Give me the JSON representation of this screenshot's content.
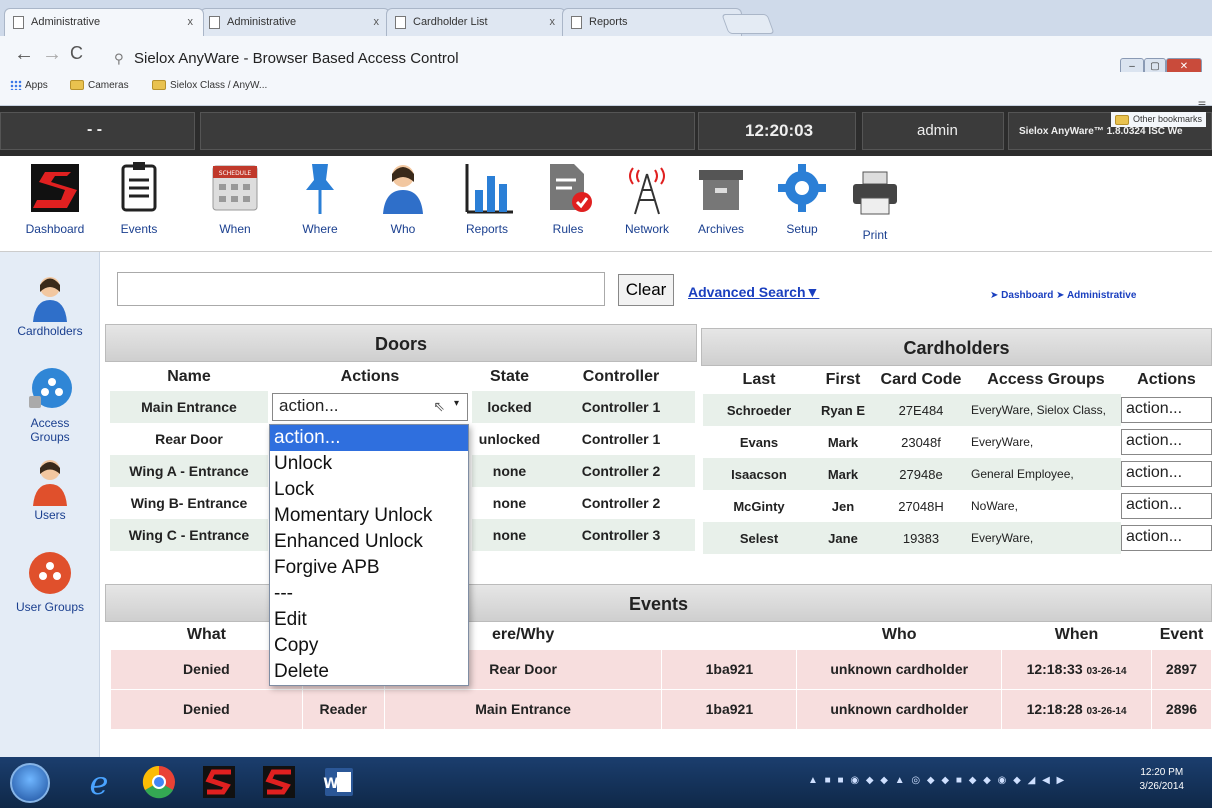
{
  "browser": {
    "tabs": [
      {
        "label": "Administrative",
        "active": true
      },
      {
        "label": "Administrative",
        "active": false
      },
      {
        "label": "Cardholder List",
        "active": false
      },
      {
        "label": "Reports",
        "active": false
      }
    ],
    "tab_close": "x",
    "address": "Sielox AnyWare - Browser Based Access Control",
    "bookmarks": [
      "Apps",
      "Cameras",
      "Sielox Class / AnyW..."
    ],
    "other_bookmarks": "Other bookmarks"
  },
  "header": {
    "dashes": "- -",
    "time": "12:20:03",
    "user": "admin",
    "version": "Sielox AnyWare™ 1.8.0324 ISC We"
  },
  "toolbar": {
    "items": [
      "Dashboard",
      "Events",
      "When",
      "Where",
      "Who",
      "Reports",
      "Rules",
      "Network",
      "Archives",
      "Setup",
      "Print"
    ],
    "schedule_badge": "SCHEDULE"
  },
  "sidebar": {
    "items": [
      "Cardholders",
      "Access Groups",
      "Users",
      "User Groups"
    ]
  },
  "search": {
    "value": "",
    "clear_label": "Clear",
    "advanced_label": "Advanced Search▼",
    "breadcrumb": "➤ Dashboard ➤ Administrative"
  },
  "doors": {
    "title": "Doors",
    "headers": [
      "Name",
      "Actions",
      "State",
      "Controller"
    ],
    "rows": [
      {
        "name": "Main Entrance",
        "action": "action...",
        "state": "locked",
        "controller": "Controller 1"
      },
      {
        "name": "Rear Door",
        "action": "",
        "state": "unlocked",
        "controller": "Controller 1"
      },
      {
        "name": "Wing A - Entrance",
        "action": "",
        "state": "none",
        "controller": "Controller 2"
      },
      {
        "name": "Wing B- Entrance",
        "action": "",
        "state": "none",
        "controller": "Controller 2"
      },
      {
        "name": "Wing C - Entrance",
        "action": "",
        "state": "none",
        "controller": "Controller 3"
      }
    ],
    "dropdown_options": [
      "action...",
      "Unlock",
      "Lock",
      "Momentary Unlock",
      "Enhanced Unlock",
      "Forgive APB",
      "---",
      "Edit",
      "Copy",
      "Delete"
    ]
  },
  "cardholders": {
    "title": "Cardholders",
    "headers": [
      "Last",
      "First",
      "Card Code",
      "Access Groups",
      "Actions"
    ],
    "rows": [
      {
        "last": "Schroeder",
        "first": "Ryan E",
        "code": "27E484",
        "groups": "EveryWare, Sielox Class,",
        "action": "action..."
      },
      {
        "last": "Evans",
        "first": "Mark",
        "code": "23048f",
        "groups": "EveryWare,",
        "action": "action..."
      },
      {
        "last": "Isaacson",
        "first": "Mark",
        "code": "27948e",
        "groups": "General Employee,",
        "action": "action..."
      },
      {
        "last": "McGinty",
        "first": "Jen",
        "code": "27048H",
        "groups": "NoWare,",
        "action": "action..."
      },
      {
        "last": "Selest",
        "first": "Jane",
        "code": "19383",
        "groups": "EveryWare,",
        "action": "action..."
      }
    ]
  },
  "events": {
    "title": "Events",
    "headers": [
      "What",
      "ere/Why",
      "Who",
      "When",
      "Event"
    ],
    "rows": [
      {
        "what": "Denied",
        "how": "",
        "where": "Rear Door",
        "card": "1ba921",
        "who": "unknown cardholder",
        "time": "12:18:33",
        "date": "03-26-14",
        "id": "2897"
      },
      {
        "what": "Denied",
        "how": "Reader",
        "where": "Main Entrance",
        "card": "1ba921",
        "who": "unknown cardholder",
        "time": "12:18:28",
        "date": "03-26-14",
        "id": "2896"
      }
    ]
  },
  "taskbar": {
    "clock_time": "12:20 PM",
    "clock_date": "3/26/2014"
  },
  "colors": {
    "accent_blue": "#1a3fbf",
    "header_dark": "#2c2c2c",
    "row_green": "#e8f0ea",
    "row_pink": "#f7dede",
    "highlight": "#2f6fde"
  }
}
